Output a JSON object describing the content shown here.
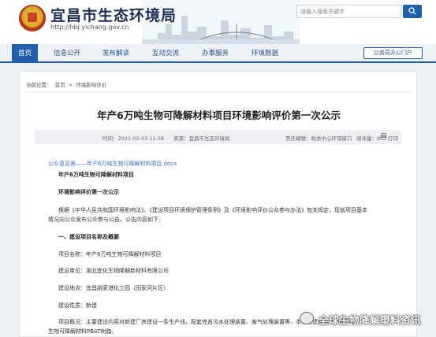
{
  "header": {
    "title": "宜昌市生态环境局",
    "url": "http://hbj.yichang.gov.cn",
    "search_placeholder": "请输入搜索关键字"
  },
  "nav": {
    "items": [
      "首页",
      "信息公开",
      "发布解读",
      "互动交流",
      "办事服务",
      "环境数据"
    ],
    "portal_label": "公务员办公门户"
  },
  "breadcrumb": {
    "prefix": "当前位置：",
    "home": "首页",
    "sep": ">",
    "section": "环境影响评价"
  },
  "article": {
    "title": "年产6万吨生物可降解材料项目环境影响评价第一次公示",
    "time_label": "时间：2021-02-03 11:38",
    "source_label": "来源：宜昌市生态环境局",
    "editor_label": "责任编辑：政务中心环保窗口",
    "views_label": "阅读量：91",
    "print_label": "打印",
    "attachment": "公众意见表——年产6万吨生物可降解材料项目.docx",
    "project_heading": "年产6万吨生物可降解材料项目",
    "notice_heading": "环境影响评价第一次公示",
    "intro_line1": "根据《中华人民共和国环境影响法》、《建设项目环境保护管理条例》及《环境影响评价公众参与办法》有关规定，现就项目基本",
    "intro_line2": "情况向公众发布公众参与公告。公告内容如下：",
    "section1_heading": "一、建设项目名称及概要",
    "project_name": "项目名称：年产6万吨生物可降解材料项目",
    "builder": "建设单位：湖北宜化生物降解新材料有限公司",
    "location": "建设地点：宜昌姚家港化工园（田家河片区）",
    "nature": "建设性质：新建",
    "overview_line1": "项目概况：主要建设内容对新建厂房建设一条生产线，配套完善污水处理装置、废气处理装置等，本项目建成后年产6万吨",
    "overview_line2": "生物可降解材料PBAT树脂。"
  },
  "watermark": {
    "text": "全球生物降解塑料资讯"
  }
}
